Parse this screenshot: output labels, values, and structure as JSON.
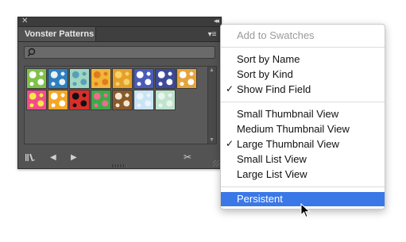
{
  "panel": {
    "close_glyph": "✕",
    "collapse_glyph": "◂◂",
    "tab_label": "Vonster Patterns",
    "menu_glyph": "▾≡",
    "swatches": [
      {
        "colors": [
          "#7fc24a",
          "#ffffff"
        ]
      },
      {
        "colors": [
          "#2f7fbf",
          "#e8f2f7"
        ]
      },
      {
        "colors": [
          "#9fd6c2",
          "#5a9fb8"
        ]
      },
      {
        "colors": [
          "#f0b63a",
          "#e07a1f"
        ]
      },
      {
        "colors": [
          "#e5a02a",
          "#f6d16b"
        ]
      },
      {
        "colors": [
          "#4b5bb8",
          "#ffffff"
        ]
      },
      {
        "colors": [
          "#3d4a9c",
          "#ffffff"
        ]
      },
      {
        "colors": [
          "#e4a43c",
          "#ffffff"
        ]
      },
      {
        "colors": [
          "#f24d8a",
          "#f7e84a"
        ]
      },
      {
        "colors": [
          "#f5a623",
          "#ffffff"
        ]
      },
      {
        "colors": [
          "#d82f2a",
          "#111111"
        ]
      },
      {
        "colors": [
          "#3fa94a",
          "#f26b8f"
        ]
      },
      {
        "colors": [
          "#8a5a2b",
          "#f2e7d2"
        ]
      },
      {
        "colors": [
          "#c9e4f4",
          "#e9f4fb"
        ]
      },
      {
        "colors": [
          "#bfe3cf",
          "#e8f5ec"
        ]
      }
    ],
    "bottom": {
      "library_icon": "library-icon",
      "prev_icon": "◀",
      "next_icon": "▶",
      "tools_icon": "✂"
    }
  },
  "menu": {
    "add_to_swatches": "Add to Swatches",
    "sort_by_name": "Sort by Name",
    "sort_by_kind": "Sort by Kind",
    "show_find_field": "Show Find Field",
    "small_thumb": "Small Thumbnail View",
    "medium_thumb": "Medium Thumbnail View",
    "large_thumb": "Large Thumbnail View",
    "small_list": "Small List View",
    "large_list": "Large List View",
    "persistent": "Persistent",
    "check": "✓"
  }
}
